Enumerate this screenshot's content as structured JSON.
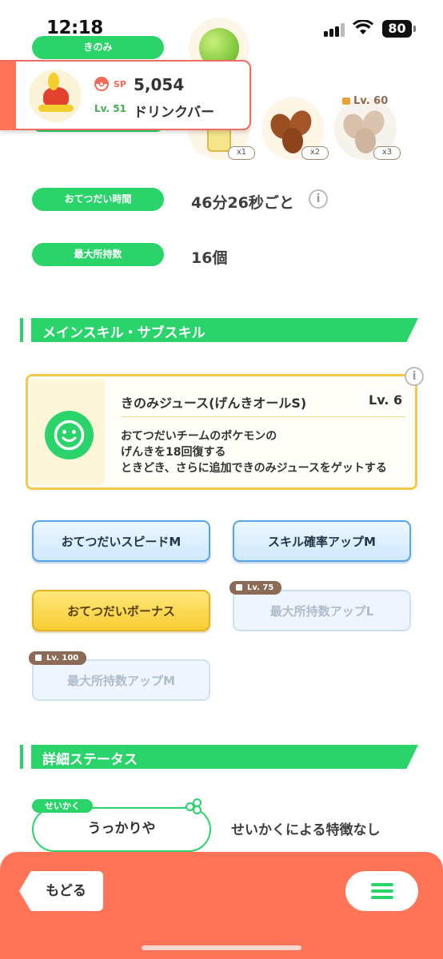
{
  "status_bar": {
    "time": "12:18",
    "battery": "80"
  },
  "berry": {
    "pill_label": "きのみ"
  },
  "ingredients": [
    {
      "count": "x1"
    },
    {
      "count": "x2"
    },
    {
      "count": "x3",
      "lock_label": "Lv. 60"
    }
  ],
  "pokemon": {
    "sp_label": "SP",
    "sp_value": "5,054",
    "level": "Lv. 51",
    "name": "ドリンクバー"
  },
  "help_time": {
    "label": "おてつだい時間",
    "value": "46分26秒ごと",
    "info_icon": "i"
  },
  "max_carry": {
    "label": "最大所持数",
    "value": "16個"
  },
  "skill_section": {
    "title": "メインスキル・サブスキル"
  },
  "main_skill": {
    "name": "きのみジュース(げんきオールS)",
    "level": "Lv. 6",
    "desc_line1": "おてつだいチームのポケモンの",
    "desc_line2": "げんきを18回復する",
    "desc_line3": "ときどき、さらに追加できのみジュースをゲットする",
    "info_icon": "i"
  },
  "subskills": [
    {
      "label": "おてつだいスピードM",
      "state": "unlocked"
    },
    {
      "label": "スキル確率アップM",
      "state": "unlocked"
    },
    {
      "label": "おてつだいボーナス",
      "state": "gold"
    },
    {
      "label": "最大所持数アップL",
      "state": "locked",
      "lock_label": "Lv. 75"
    },
    {
      "label": "最大所持数アップM",
      "state": "locked",
      "lock_label": "Lv. 100"
    }
  ],
  "detail_section": {
    "title": "詳細ステータス"
  },
  "nature": {
    "tag": "せいかく",
    "value": "うっかりや",
    "description": "せいかくによる特徴なし"
  },
  "bottom_bar": {
    "back_label": "もどる"
  },
  "colors": {
    "accent_green": "#2bd46a",
    "bottom_bar": "#ff7456",
    "gold": "#f3c94a"
  },
  "icons": [
    "signal-icon",
    "wifi-icon",
    "battery-icon",
    "lock-icon",
    "info-icon",
    "smile-icon",
    "menu-icon",
    "clover-icon"
  ]
}
